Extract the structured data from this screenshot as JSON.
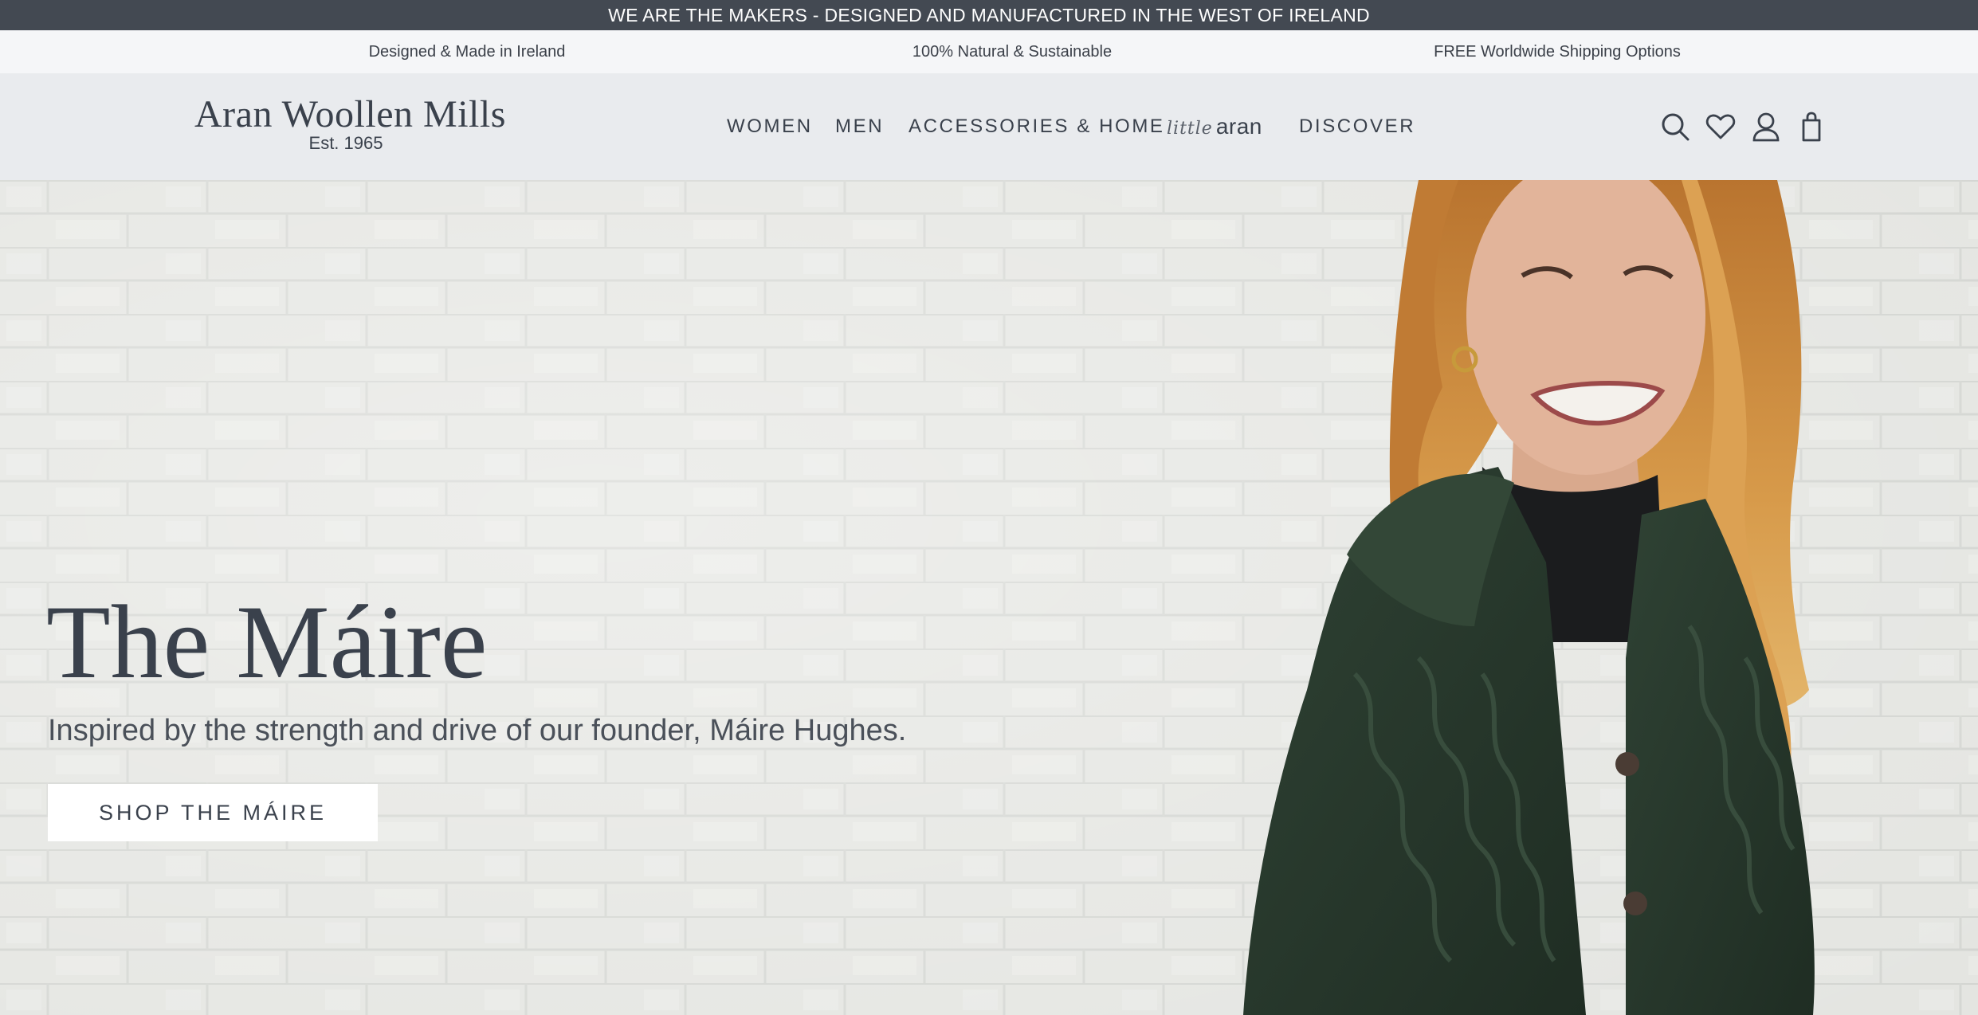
{
  "announcement": {
    "text": "WE ARE THE MAKERS - DESIGNED AND MANUFACTURED IN THE WEST OF IRELAND"
  },
  "usps": [
    "Designed & Made in Ireland",
    "100% Natural & Sustainable",
    "FREE Worldwide Shipping Options"
  ],
  "header": {
    "logo_name": "Aran Woollen Mills",
    "logo_est": "Est. 1965",
    "nav": {
      "women": "WOMEN",
      "men": "MEN",
      "accessories_home": "ACCESSORIES & HOME",
      "little_aran_script": "little",
      "little_aran_word": "aran",
      "discover": "DISCOVER"
    },
    "icons": [
      "search-icon",
      "heart-icon",
      "account-icon",
      "bag-icon"
    ]
  },
  "hero": {
    "title": "The Máire",
    "subtitle": "Inspired by the strength and drive of our founder, Máire Hughes.",
    "cta_label": "SHOP THE MÁIRE"
  },
  "colors": {
    "topbar_bg": "#434952",
    "usp_bg": "#f5f6f8",
    "header_bg": "#e9ebee",
    "text_primary": "#3a414c",
    "cardigan_green": "#27372b",
    "hair": "#c98a3e"
  }
}
